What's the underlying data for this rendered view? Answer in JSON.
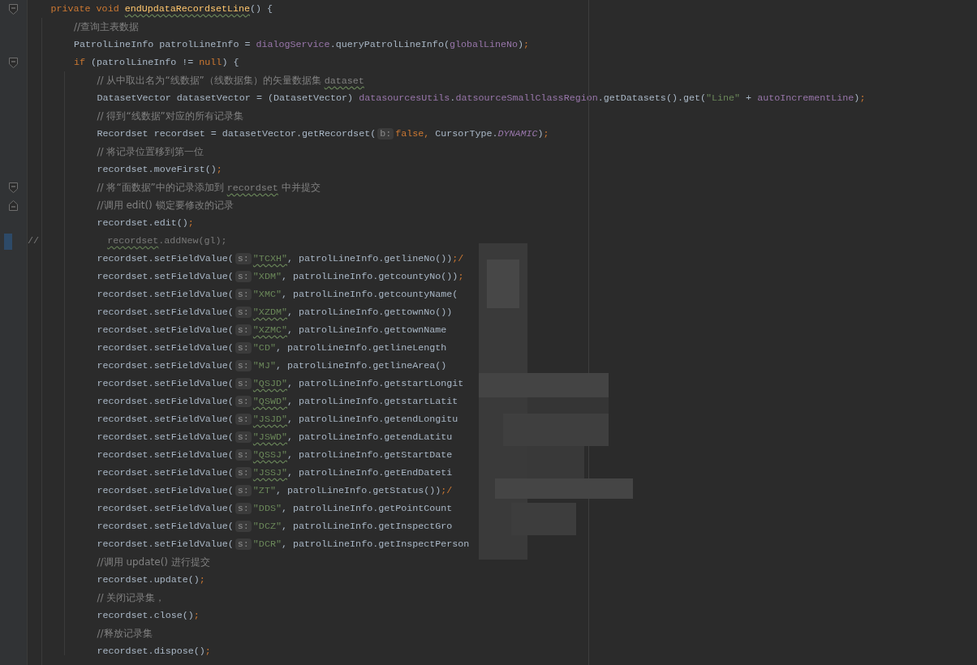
{
  "editor": {
    "lines": [
      {
        "fold_start": true,
        "tokens": [
          {
            "text": "private void ",
            "kind": "keyword"
          },
          {
            "text": "endUpdataRecordsetLine",
            "kind": "declaration",
            "squiggle": true
          },
          {
            "text": "() {",
            "kind": "plain"
          }
        ],
        "children": [
          {
            "tokens": [
              {
                "text": "//查询主表数据",
                "kind": "comment"
              }
            ]
          },
          {
            "tokens": [
              {
                "text": "PatrolLineInfo patrolLineInfo = ",
                "kind": "plain"
              },
              {
                "text": "dialogService",
                "kind": "field"
              },
              {
                "text": ".queryPatrolLineInfo(",
                "kind": "plain"
              },
              {
                "text": "globalLineNo",
                "kind": "field"
              },
              {
                "text": ")",
                "kind": "plain"
              },
              {
                "text": ";",
                "kind": "punct"
              }
            ]
          },
          {
            "fold_start": true,
            "tokens": [
              {
                "text": "if",
                "kind": "keyword"
              },
              {
                "text": " (patrolLineInfo != ",
                "kind": "plain"
              },
              {
                "text": "null",
                "kind": "keyword"
              },
              {
                "text": ") {",
                "kind": "plain"
              }
            ],
            "children": [
              {
                "tokens": [
                  {
                    "text": "// 从中取出名为“线数据”（线数据集）的矢量数据集 ",
                    "kind": "comment"
                  },
                  {
                    "text": "dataset",
                    "kind": "comment",
                    "squiggle": true
                  }
                ]
              },
              {
                "tokens": [
                  {
                    "text": "DatasetVector datasetVector = (DatasetVector) ",
                    "kind": "plain"
                  },
                  {
                    "text": "datasourcesUtils",
                    "kind": "field"
                  },
                  {
                    "text": ".",
                    "kind": "plain"
                  },
                  {
                    "text": "datsourceSmallClassRegion",
                    "kind": "field"
                  },
                  {
                    "text": ".getDatasets().get(",
                    "kind": "plain"
                  },
                  {
                    "text": "\"Line\"",
                    "kind": "string"
                  },
                  {
                    "text": " + ",
                    "kind": "plain"
                  },
                  {
                    "text": "autoIncrementLine",
                    "kind": "field"
                  },
                  {
                    "text": ")",
                    "kind": "plain"
                  },
                  {
                    "text": ";",
                    "kind": "punct"
                  }
                ]
              },
              {
                "tokens": [
                  {
                    "text": "// 得到“线数据”对应的所有记录集",
                    "kind": "comment"
                  }
                ]
              },
              {
                "tokens": [
                  {
                    "text": "Recordset recordset = datasetVector.getRecordset(",
                    "kind": "plain"
                  },
                  {
                    "text": "b:",
                    "kind": "hint"
                  },
                  {
                    "text": "false",
                    "kind": "keyword"
                  },
                  {
                    "text": ",",
                    "kind": "punct"
                  },
                  {
                    "text": " CursorType.",
                    "kind": "plain"
                  },
                  {
                    "text": "DYNAMIC",
                    "kind": "constant"
                  },
                  {
                    "text": ")",
                    "kind": "plain"
                  },
                  {
                    "text": ";",
                    "kind": "punct"
                  }
                ]
              },
              {
                "tokens": [
                  {
                    "text": "// 将记录位置移到第一位",
                    "kind": "comment"
                  }
                ]
              },
              {
                "tokens": [
                  {
                    "text": "recordset.moveFirst()",
                    "kind": "plain"
                  },
                  {
                    "text": ";",
                    "kind": "punct"
                  }
                ]
              },
              {
                "fold_start": true,
                "tokens": [
                  {
                    "text": "// 将“面数据”中的记录添加到 ",
                    "kind": "comment"
                  },
                  {
                    "text": "recordset",
                    "kind": "comment",
                    "squiggle": true
                  },
                  {
                    "text": " 中并提交",
                    "kind": "comment"
                  }
                ]
              },
              {
                "fold_end": true,
                "tokens": [
                  {
                    "text": "//调用 edit() 锁定要修改的记录",
                    "kind": "comment"
                  }
                ]
              },
              {
                "tokens": [
                  {
                    "text": "recordset.edit()",
                    "kind": "plain"
                  },
                  {
                    "text": ";",
                    "kind": "punct"
                  }
                ]
              },
              {
                "commented": true,
                "changed": true,
                "tokens": [
                  {
                    "text": "//            ",
                    "kind": "comment"
                  },
                  {
                    "text": "recordset",
                    "kind": "comment",
                    "squiggle": true
                  },
                  {
                    "text": ".addNew(gl);",
                    "kind": "comment"
                  }
                ]
              },
              {
                "tokens": [
                  {
                    "text": "recordset.setFieldValue(",
                    "kind": "plain"
                  },
                  {
                    "text": "s:",
                    "kind": "hint"
                  },
                  {
                    "text": "\"TCXH\"",
                    "kind": "string",
                    "squiggle": true
                  },
                  {
                    "text": ", patrolLineInfo.getlineNo())",
                    "kind": "plain"
                  },
                  {
                    "text": ";/",
                    "kind": "punct"
                  }
                ]
              },
              {
                "tokens": [
                  {
                    "text": "recordset.setFieldValue(",
                    "kind": "plain"
                  },
                  {
                    "text": "s:",
                    "kind": "hint"
                  },
                  {
                    "text": "\"XDM\"",
                    "kind": "string"
                  },
                  {
                    "text": ", patrolLineInfo.getcountyNo())",
                    "kind": "plain"
                  },
                  {
                    "text": ";",
                    "kind": "punct"
                  }
                ]
              },
              {
                "tokens": [
                  {
                    "text": "recordset.setFieldValue(",
                    "kind": "plain"
                  },
                  {
                    "text": "s:",
                    "kind": "hint"
                  },
                  {
                    "text": "\"XMC\"",
                    "kind": "string"
                  },
                  {
                    "text": ", patrolLineInfo.getcountyName(",
                    "kind": "plain"
                  }
                ]
              },
              {
                "tokens": [
                  {
                    "text": "recordset.setFieldValue(",
                    "kind": "plain"
                  },
                  {
                    "text": "s:",
                    "kind": "hint"
                  },
                  {
                    "text": "\"XZDM\"",
                    "kind": "string",
                    "squiggle": true
                  },
                  {
                    "text": ", patrolLineInfo.gettownNo())",
                    "kind": "plain"
                  }
                ]
              },
              {
                "tokens": [
                  {
                    "text": "recordset.setFieldValue(",
                    "kind": "plain"
                  },
                  {
                    "text": "s:",
                    "kind": "hint"
                  },
                  {
                    "text": "\"XZMC\"",
                    "kind": "string",
                    "squiggle": true
                  },
                  {
                    "text": ", patrolLineInfo.gettownName",
                    "kind": "plain"
                  }
                ]
              },
              {
                "tokens": [
                  {
                    "text": "recordset.setFieldValue(",
                    "kind": "plain"
                  },
                  {
                    "text": "s:",
                    "kind": "hint"
                  },
                  {
                    "text": "\"CD\"",
                    "kind": "string"
                  },
                  {
                    "text": ", patrolLineInfo.getlineLength",
                    "kind": "plain"
                  }
                ]
              },
              {
                "tokens": [
                  {
                    "text": "recordset.setFieldValue(",
                    "kind": "plain"
                  },
                  {
                    "text": "s:",
                    "kind": "hint"
                  },
                  {
                    "text": "\"MJ\"",
                    "kind": "string"
                  },
                  {
                    "text": ", patrolLineInfo.getlineArea()",
                    "kind": "plain"
                  }
                ]
              },
              {
                "tokens": [
                  {
                    "text": "recordset.setFieldValue(",
                    "kind": "plain"
                  },
                  {
                    "text": "s:",
                    "kind": "hint"
                  },
                  {
                    "text": "\"QSJD\"",
                    "kind": "string",
                    "squiggle": true
                  },
                  {
                    "text": ", patrolLineInfo.getstartLongit",
                    "kind": "plain"
                  }
                ]
              },
              {
                "tokens": [
                  {
                    "text": "recordset.setFieldValue(",
                    "kind": "plain"
                  },
                  {
                    "text": "s:",
                    "kind": "hint"
                  },
                  {
                    "text": "\"QSWD\"",
                    "kind": "string",
                    "squiggle": true
                  },
                  {
                    "text": ", patrolLineInfo.getstartLatit",
                    "kind": "plain"
                  }
                ]
              },
              {
                "tokens": [
                  {
                    "text": "recordset.setFieldValue(",
                    "kind": "plain"
                  },
                  {
                    "text": "s:",
                    "kind": "hint"
                  },
                  {
                    "text": "\"JSJD\"",
                    "kind": "string",
                    "squiggle": true
                  },
                  {
                    "text": ", patrolLineInfo.getendLongitu",
                    "kind": "plain"
                  }
                ]
              },
              {
                "tokens": [
                  {
                    "text": "recordset.setFieldValue(",
                    "kind": "plain"
                  },
                  {
                    "text": "s:",
                    "kind": "hint"
                  },
                  {
                    "text": "\"JSWD\"",
                    "kind": "string",
                    "squiggle": true
                  },
                  {
                    "text": ", patrolLineInfo.getendLatitu",
                    "kind": "plain"
                  }
                ]
              },
              {
                "tokens": [
                  {
                    "text": "recordset.setFieldValue(",
                    "kind": "plain"
                  },
                  {
                    "text": "s:",
                    "kind": "hint"
                  },
                  {
                    "text": "\"QSSJ\"",
                    "kind": "string",
                    "squiggle": true
                  },
                  {
                    "text": ", patrolLineInfo.getStartDate",
                    "kind": "plain"
                  }
                ]
              },
              {
                "tokens": [
                  {
                    "text": "recordset.setFieldValue(",
                    "kind": "plain"
                  },
                  {
                    "text": "s:",
                    "kind": "hint"
                  },
                  {
                    "text": "\"JSSJ\"",
                    "kind": "string",
                    "squiggle": true
                  },
                  {
                    "text": ", patrolLineInfo.getEndDateti",
                    "kind": "plain"
                  }
                ]
              },
              {
                "tokens": [
                  {
                    "text": "recordset.setFieldValue(",
                    "kind": "plain"
                  },
                  {
                    "text": "s:",
                    "kind": "hint"
                  },
                  {
                    "text": "\"ZT\"",
                    "kind": "string"
                  },
                  {
                    "text": ", patrolLineInfo.getStatus())",
                    "kind": "plain"
                  },
                  {
                    "text": ";/",
                    "kind": "punct"
                  }
                ]
              },
              {
                "tokens": [
                  {
                    "text": "recordset.setFieldValue(",
                    "kind": "plain"
                  },
                  {
                    "text": "s:",
                    "kind": "hint"
                  },
                  {
                    "text": "\"DDS\"",
                    "kind": "string"
                  },
                  {
                    "text": ", patrolLineInfo.getPointCount",
                    "kind": "plain"
                  }
                ]
              },
              {
                "tokens": [
                  {
                    "text": "recordset.setFieldValue(",
                    "kind": "plain"
                  },
                  {
                    "text": "s:",
                    "kind": "hint"
                  },
                  {
                    "text": "\"DCZ\"",
                    "kind": "string"
                  },
                  {
                    "text": ", patrolLineInfo.getInspectGro",
                    "kind": "plain"
                  }
                ]
              },
              {
                "tokens": [
                  {
                    "text": "recordset.setFieldValue(",
                    "kind": "plain"
                  },
                  {
                    "text": "s:",
                    "kind": "hint"
                  },
                  {
                    "text": "\"DCR\"",
                    "kind": "string"
                  },
                  {
                    "text": ", patrolLineInfo.getInspectPerson",
                    "kind": "plain"
                  }
                ]
              },
              {
                "tokens": [
                  {
                    "text": "//调用 update() 进行提交",
                    "kind": "comment"
                  }
                ]
              },
              {
                "tokens": [
                  {
                    "text": "recordset.update()",
                    "kind": "plain"
                  },
                  {
                    "text": ";",
                    "kind": "punct"
                  }
                ]
              },
              {
                "tokens": [
                  {
                    "text": "// 关闭记录集，",
                    "kind": "comment"
                  }
                ]
              },
              {
                "tokens": [
                  {
                    "text": "recordset.close()",
                    "kind": "plain"
                  },
                  {
                    "text": ";",
                    "kind": "punct"
                  }
                ]
              },
              {
                "tokens": [
                  {
                    "text": "//释放记录集",
                    "kind": "comment"
                  }
                ]
              },
              {
                "tokens": [
                  {
                    "text": "recordset.dispose()",
                    "kind": "plain"
                  },
                  {
                    "text": ";",
                    "kind": "punct"
                  }
                ]
              }
            ]
          }
        ]
      }
    ]
  }
}
